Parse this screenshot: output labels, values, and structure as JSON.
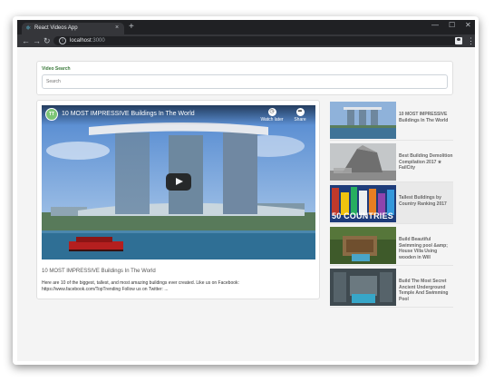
{
  "browser": {
    "tab_title": "React Videos App",
    "tab_close": "×",
    "new_tab": "+",
    "minimize": "—",
    "maximize": "☐",
    "close": "✕",
    "back": "←",
    "forward": "→",
    "reload": "↻",
    "info": "i",
    "url_host": "localhost",
    "url_port": ":3000",
    "menu": "⋮"
  },
  "search": {
    "label": "Video Search",
    "placeholder": "Search"
  },
  "video": {
    "channel": "TT",
    "title": "10 MOST IMPRESSIVE Buildings In The World",
    "watch_later": "Watch later",
    "share": "Share",
    "watch_later_icon": "clock-icon",
    "share_icon": "share-icon",
    "detail_title": "10 MOST IMPRESSIVE Buildings In The World",
    "description": "Here are 10 of the biggest, tallest, and most amazing buildings ever created. Like us on Facebook: https://www.facebook.com/TopTrending Follow us on Twitter: ..."
  },
  "list": [
    {
      "title": "10 MOST IMPRESSIVE Buildings In The World",
      "thumb": "marina-bay"
    },
    {
      "title": "Best Building Demolition Compilation 2017 ★ FailCity",
      "thumb": "demolition"
    },
    {
      "title": "Tallest Buildings by Country Ranking 2017",
      "thumb": "countries",
      "overlay": "50 COUNTRIES"
    },
    {
      "title": "Build Beautiful Swimming pool &amp; House Villa Using wooden in Will",
      "thumb": "jungle-pool"
    },
    {
      "title": "Build The Most Secret Ancient Underground Temple And Swimming Pool",
      "thumb": "underground"
    }
  ],
  "colors": {
    "accent_label": "#3b7a3b",
    "chrome_dark": "#202124"
  }
}
